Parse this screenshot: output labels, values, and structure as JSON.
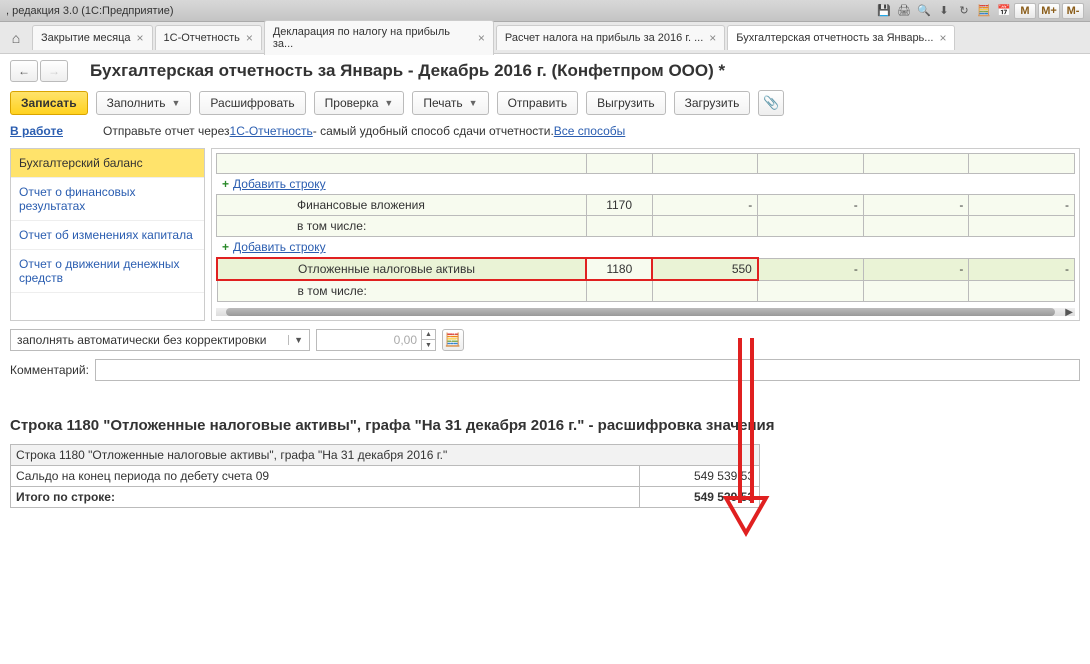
{
  "titlebar": {
    "text": ", редакция 3.0  (1С:Предприятие)",
    "m1": "M",
    "m2": "M+",
    "m3": "M-"
  },
  "tabs": [
    {
      "label": "Закрытие месяца",
      "close": "×"
    },
    {
      "label": "1С-Отчетность",
      "close": "×"
    },
    {
      "label": "Декларация по налогу на прибыль за...",
      "close": "×"
    },
    {
      "label": "Расчет налога на прибыль за 2016 г. ...",
      "close": "×"
    },
    {
      "label": "Бухгалтерская отчетность за Январь...",
      "close": "×"
    }
  ],
  "page_title": "Бухгалтерская отчетность за Январь - Декабрь 2016 г. (Конфетпром ООО) *",
  "toolbar": {
    "save": "Записать",
    "fill": "Заполнить",
    "decode": "Расшифровать",
    "check": "Проверка",
    "print": "Печать",
    "send": "Отправить",
    "export": "Выгрузить",
    "import": "Загрузить"
  },
  "status": {
    "label": "В работе",
    "text1": "Отправьте отчет через ",
    "link1": "1С-Отчетность",
    "text2": " - самый удобный способ сдачи отчетности. ",
    "link2": "Все способы"
  },
  "sidebar": [
    "Бухгалтерский баланс",
    "Отчет о финансовых результатах",
    "Отчет об изменениях капитала",
    "Отчет о движении денежных средств"
  ],
  "grid": {
    "add": "Добавить строку",
    "fin": "Финансовые вложения",
    "fin_code": "1170",
    "incl": "в том числе:",
    "dta": "Отложенные налоговые активы",
    "dta_code": "1180",
    "dta_val": "550"
  },
  "select_value": "заполнять автоматически без корректировки",
  "num_placeholder": "0,00",
  "comment_label": "Комментарий:",
  "section2": {
    "title": "Строка 1180 \"Отложенные налоговые активы\", графа \"На 31 декабря 2016 г.\" - расшифровка значения",
    "header": "Строка 1180 \"Отложенные налоговые активы\", графа \"На 31 декабря 2016 г.\"",
    "row1": "Сальдо на конец периода по дебету счета 09",
    "val1": "549 539,53",
    "total_label": "Итого по строке:",
    "total_val": "549 539,53"
  }
}
